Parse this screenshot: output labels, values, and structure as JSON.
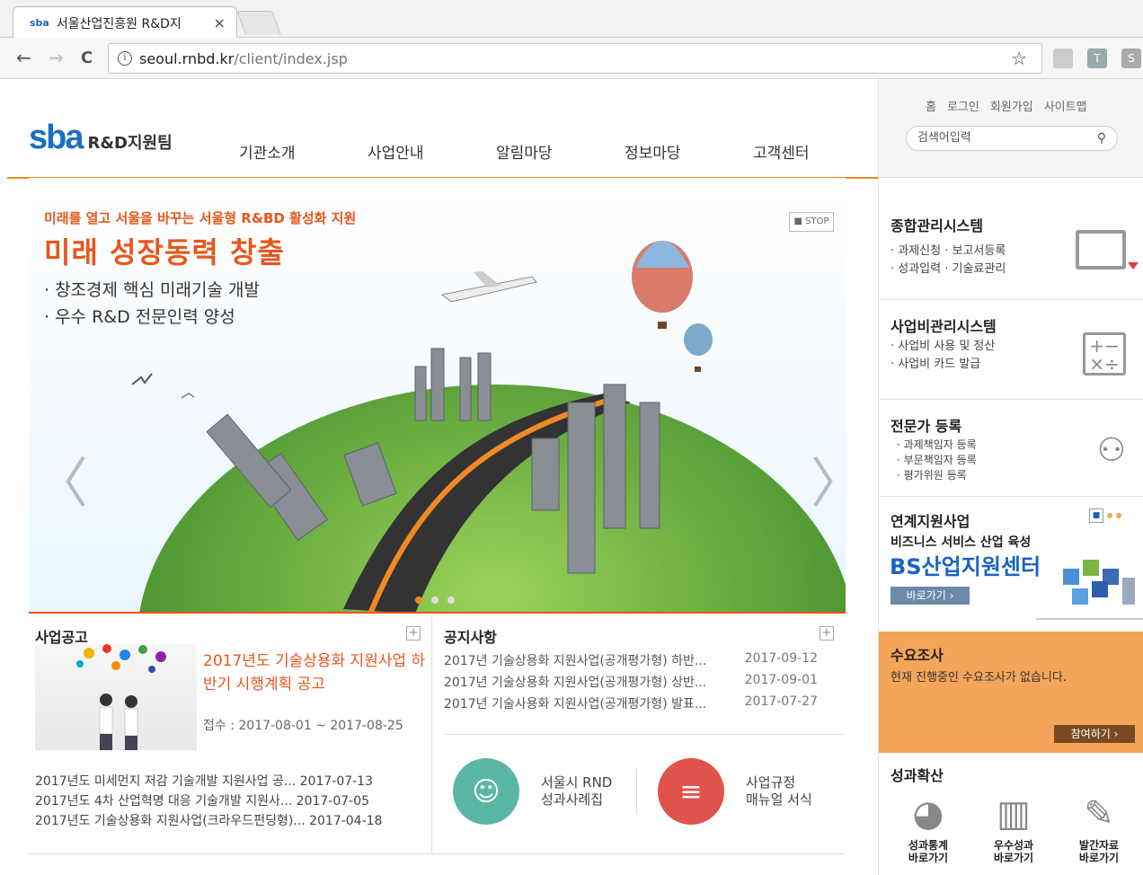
{
  "browser": {
    "tab_title": "서울산업진흥원 R&D지",
    "tab_close": "×",
    "favicon_text": "sba",
    "url_host": "seoul.rnbd.kr",
    "url_path": "/client/index.jsp",
    "back": "←",
    "forward": "→",
    "reload": "C",
    "star": "☆",
    "ext_t": "T",
    "ext_s": "S"
  },
  "header": {
    "logo_mark": "sba",
    "logo_team": "R&D지원팀",
    "nav": [
      "기관소개",
      "사업안내",
      "알림마당",
      "정보마당",
      "고객센터"
    ]
  },
  "util": {
    "links": [
      "홈",
      "로그인",
      "회원가입",
      "사이트맵"
    ],
    "search_placeholder": "검색어입력"
  },
  "hero": {
    "kicker": "미래를 열고 서울을 바꾸는 서울형 R&BD 활성화 지원",
    "title": "미래 성장동력 창출",
    "bullet1": "· 창조경제 핵심 미래기술 개발",
    "bullet2": "· 우수 R&D 전문인력 양성",
    "stop": "■ STOP",
    "prev": "〈",
    "next": "〉"
  },
  "biz": {
    "title": "사업공고",
    "main_title": "2017년도 기술상용화 지원사업 하반기 시행계획 공고",
    "period": "접수 : 2017-08-01 ~ 2017-08-25",
    "list": [
      "2017년도 미세먼지 저감 기술개발 지원사업 공... 2017-07-13",
      "2017년도 4차 산업혁명 대응 기술개발 지원사... 2017-07-05",
      "2017년도 기술상용화 지원사업(크라우드펀딩형)... 2017-04-18"
    ]
  },
  "notice": {
    "title": "공지사항",
    "rows": [
      {
        "t": "2017년 기술상용화 지원사업(공개평가형) 하반...",
        "d": "2017-09-12"
      },
      {
        "t": "2017년 기술상용화 지원사업(공개평가형) 상반...",
        "d": "2017-09-01"
      },
      {
        "t": "2017년 기술사용화 지원사업(공개평가형) 발표...",
        "d": "2017-07-27"
      }
    ]
  },
  "quick": {
    "q1_line1": "서울시 RND",
    "q1_line2": "성과사례집",
    "q2_line1": "사업규정",
    "q2_line2": "매뉴얼 서식"
  },
  "side": {
    "sys1_title": "종합관리시스템",
    "sys1_items": [
      "· 과제신청  · 보고서등록",
      "· 성과입력  · 기술료관리"
    ],
    "sys2_title": "사업비관리시스템",
    "sys2_items": [
      "· 사업비 사용 및 정산",
      "· 사업비 카드 발급"
    ],
    "sys3_title": "전문가 등록",
    "sys3_items": [
      "· 과제책임자 등록",
      "· 부문책임자 등록",
      "· 평가위원 등록"
    ],
    "link_title": "연계지원사업",
    "link_sub": "비즈니스 서비스 산업 육성",
    "link_big": "BS산업지원센터",
    "link_go": "바로가기 ›",
    "survey_title": "수요조사",
    "survey_msg": "현재 진행중인 수요조사가 없습니다.",
    "survey_join": "참여하기 ›",
    "perf_title": "성과확산",
    "perf_items": [
      {
        "l1": "성과통계",
        "l2": "바로가기"
      },
      {
        "l1": "우수성과",
        "l2": "바로가기"
      },
      {
        "l1": "발간자료",
        "l2": "바로가기"
      }
    ]
  }
}
